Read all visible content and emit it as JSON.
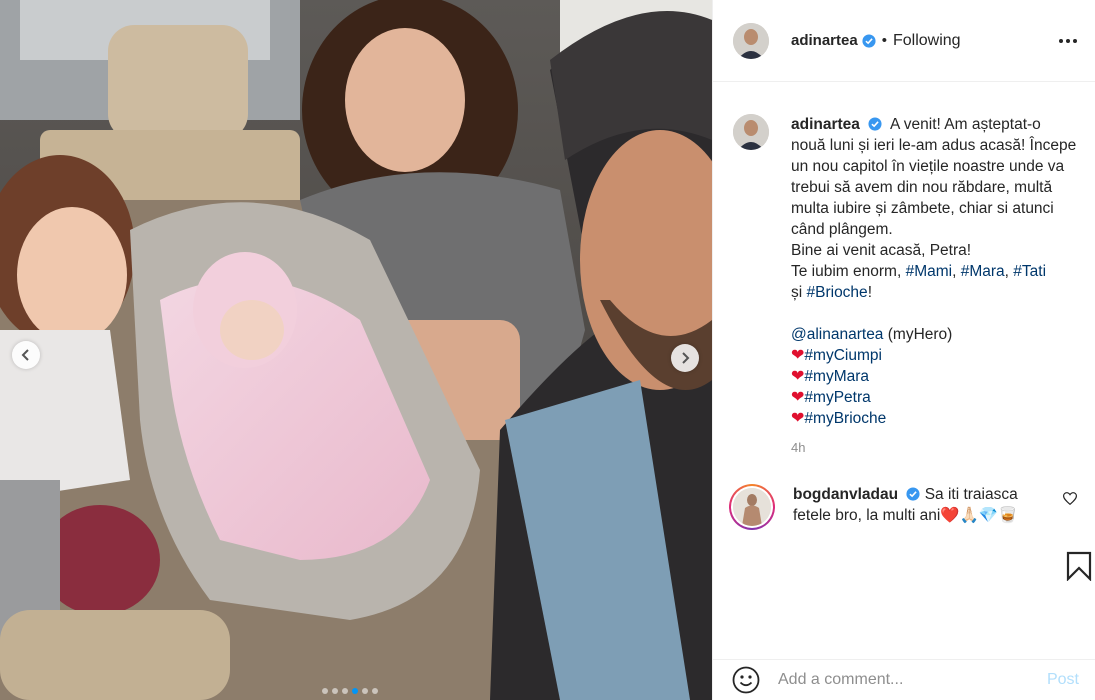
{
  "post": {
    "author": "adinartea",
    "follow_separator": "•",
    "follow_status": "Following",
    "caption_parts": [
      {
        "t": "A venit! Am așteptat-o nouă luni și ieri le-am adus acasă! Începe un nou capitol în viețile noastre unde va trebui să avem din nou răbdare, multă multa iubire și zâmbete, chiar si atunci când plângem.\nBine ai venit acasă, Petra!\nTe iubim enorm, ",
        "tag": false
      },
      {
        "t": "#Mami",
        "tag": true
      },
      {
        "t": ", ",
        "tag": false
      },
      {
        "t": "#Mara",
        "tag": true
      },
      {
        "t": ", ",
        "tag": false
      },
      {
        "t": "#Tati",
        "tag": true
      },
      {
        "t": "\nși ",
        "tag": false
      },
      {
        "t": "#Brioche",
        "tag": true
      },
      {
        "t": "!\n\n",
        "tag": false
      },
      {
        "t": "@alinanartea",
        "tag": true
      },
      {
        "t": " (myHero)",
        "tag": false
      }
    ],
    "heart_tags": [
      "#myCiumpi",
      "#myMara",
      "#myPetra",
      "#myBrioche"
    ],
    "heart_glyph": "❤",
    "time": "4h"
  },
  "comment": {
    "author": "bogdanvladau",
    "text": "Sa iti traiasca fetele bro, la multi ani",
    "emojis": "❤️🙏🏻💎🥃"
  },
  "composer": {
    "placeholder": "Add a comment...",
    "post_label": "Post"
  },
  "carousel": {
    "count": 6,
    "active_index": 3
  },
  "colors": {
    "verified": "#3897f0",
    "link": "#00376b",
    "heart": "#e0102f",
    "post_disabled": "#b2dffc"
  },
  "icons": [
    "more-options-icon",
    "verified-icon",
    "heart-outline-icon",
    "bookmark-icon",
    "emoji-icon",
    "chevron-left-icon",
    "chevron-right-icon"
  ]
}
